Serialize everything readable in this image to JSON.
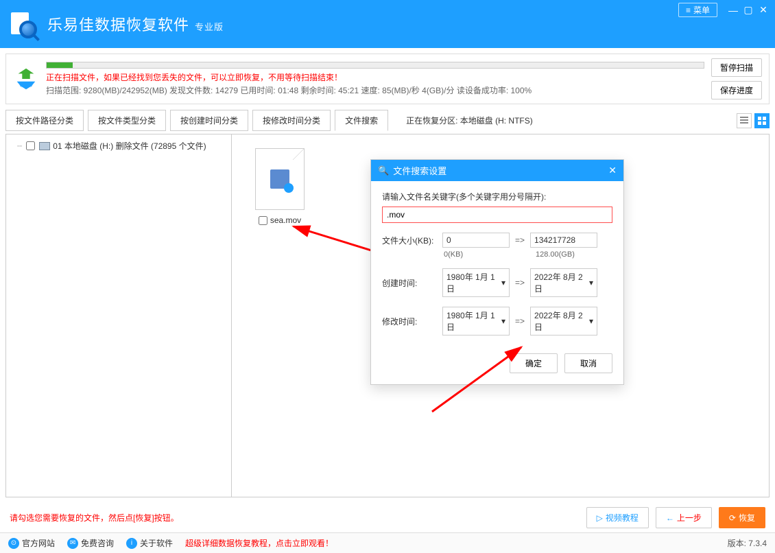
{
  "header": {
    "app_title": "乐易佳数据恢复软件",
    "app_sub": "专业版",
    "menu_label": "菜单"
  },
  "scan": {
    "line1": "正在扫描文件，如果已经找到您丢失的文件，可以立即恢复，不用等待扫描结束！",
    "line2": "扫描范围: 9280(MB)/242952(MB)    发现文件数: 14279    已用时间: 01:48    剩余时间: 45:21    速度: 85(MB)/秒  4(GB)/分  读设备成功率: 100%",
    "btn_pause": "暂停扫描",
    "btn_save": "保存进度"
  },
  "tabs": {
    "t1": "按文件路径分类",
    "t2": "按文件类型分类",
    "t3": "按创建时间分类",
    "t4": "按修改时间分类",
    "t5": "文件搜索",
    "status": "正在恢复分区: 本地磁盘 (H: NTFS)"
  },
  "tree": {
    "node0": "01 本地磁盘 (H:) 删除文件  (72895 个文件)"
  },
  "file": {
    "name": "sea.mov"
  },
  "modal": {
    "title": "文件搜索设置",
    "kw_label": "请输入文件名关键字(多个关键字用分号隔开):",
    "kw_value": ".mov",
    "size_label": "文件大小(KB):",
    "size_from": "0",
    "size_to": "134217728",
    "size_from_hint": "0(KB)",
    "size_to_hint": "128.00(GB)",
    "create_label": "创建时间:",
    "modify_label": "修改时间:",
    "date_from": "1980年 1月 1日",
    "date_to": "2022年 8月 2日",
    "ok": "确定",
    "cancel": "取消",
    "arrow": "=>"
  },
  "footer": {
    "hint": "请勾选您需要恢复的文件，然后点[恢复]按钮。",
    "video": "视频教程",
    "prev": "上一步",
    "recover": "恢复"
  },
  "bottom": {
    "l1": "官方网站",
    "l2": "免费咨询",
    "l3": "关于软件",
    "promo": "超级详细数据恢复教程，点击立即观看！",
    "version": "版本: 7.3.4"
  }
}
